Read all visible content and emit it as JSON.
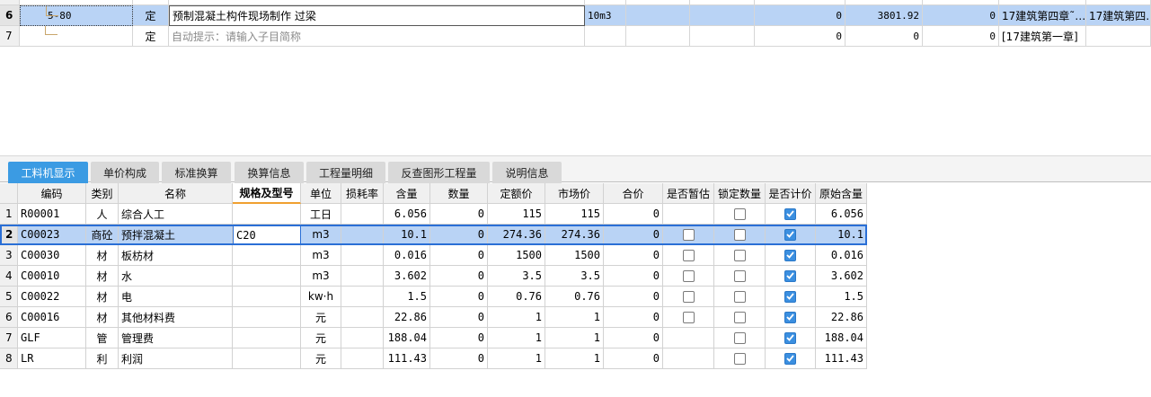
{
  "top_grid": {
    "partial_row": {
      "cells": [
        "",
        "",
        "",
        "",
        "",
        "",
        "",
        "",
        "",
        ""
      ]
    },
    "rows": [
      {
        "index": "6",
        "code": "5-80",
        "type": "定",
        "name": "预制混凝土构件现场制作 过梁",
        "unit": "10m3",
        "c1": "",
        "c2": "",
        "c3": "0",
        "c4": "3801.92",
        "c5": "0",
        "chapter": "17建筑第四章˜…",
        "chapter2": "17建筑第四…"
      },
      {
        "index": "7",
        "code": "",
        "type": "定",
        "name": "自动提示：请输入子目简称",
        "unit": "",
        "c1": "",
        "c2": "",
        "c3": "0",
        "c4": "0",
        "c5": "0",
        "chapter": "[17建筑第一章]",
        "chapter2": ""
      }
    ]
  },
  "tabs": [
    {
      "label": "工料机显示",
      "active": true
    },
    {
      "label": "单价构成",
      "active": false
    },
    {
      "label": "标准换算",
      "active": false
    },
    {
      "label": "换算信息",
      "active": false
    },
    {
      "label": "工程量明细",
      "active": false
    },
    {
      "label": "反查图形工程量",
      "active": false
    },
    {
      "label": "说明信息",
      "active": false
    }
  ],
  "table": {
    "headers": [
      "编码",
      "类别",
      "名称",
      "规格及型号",
      "单位",
      "损耗率",
      "含量",
      "数量",
      "定额价",
      "市场价",
      "合价",
      "是否暂估",
      "锁定数量",
      "是否计价",
      "原始含量"
    ],
    "rows": [
      {
        "idx": "1",
        "code": "R00001",
        "cat": "人",
        "name": "综合人工",
        "spec": "",
        "unit": "工日",
        "loss": "",
        "qty": "6.056",
        "amount": "0",
        "quota": "115",
        "market": "115",
        "total": "0",
        "est": null,
        "lock": false,
        "priced": true,
        "orig": "6.056"
      },
      {
        "idx": "2",
        "code": "C00023",
        "cat": "商砼",
        "name": "预拌混凝土",
        "spec": "C20",
        "unit": "m3",
        "loss": "",
        "qty": "10.1",
        "amount": "0",
        "quota": "274.36",
        "market": "274.36",
        "total": "0",
        "est": false,
        "lock": false,
        "priced": true,
        "orig": "10.1"
      },
      {
        "idx": "3",
        "code": "C00030",
        "cat": "材",
        "name": "板枋材",
        "spec": "",
        "unit": "m3",
        "loss": "",
        "qty": "0.016",
        "amount": "0",
        "quota": "1500",
        "market": "1500",
        "total": "0",
        "est": false,
        "lock": false,
        "priced": true,
        "orig": "0.016"
      },
      {
        "idx": "4",
        "code": "C00010",
        "cat": "材",
        "name": "水",
        "spec": "",
        "unit": "m3",
        "loss": "",
        "qty": "3.602",
        "amount": "0",
        "quota": "3.5",
        "market": "3.5",
        "total": "0",
        "est": false,
        "lock": false,
        "priced": true,
        "orig": "3.602"
      },
      {
        "idx": "5",
        "code": "C00022",
        "cat": "材",
        "name": "电",
        "spec": "",
        "unit": "kw·h",
        "loss": "",
        "qty": "1.5",
        "amount": "0",
        "quota": "0.76",
        "market": "0.76",
        "total": "0",
        "est": false,
        "lock": false,
        "priced": true,
        "orig": "1.5"
      },
      {
        "idx": "6",
        "code": "C00016",
        "cat": "材",
        "name": "其他材料费",
        "spec": "",
        "unit": "元",
        "loss": "",
        "qty": "22.86",
        "amount": "0",
        "quota": "1",
        "market": "1",
        "total": "0",
        "est": false,
        "lock": false,
        "priced": true,
        "orig": "22.86"
      },
      {
        "idx": "7",
        "code": "GLF",
        "cat": "管",
        "name": "管理费",
        "spec": "",
        "unit": "元",
        "loss": "",
        "qty": "188.04",
        "amount": "0",
        "quota": "1",
        "market": "1",
        "total": "0",
        "est": null,
        "lock": false,
        "priced": true,
        "orig": "188.04"
      },
      {
        "idx": "8",
        "code": "LR",
        "cat": "利",
        "name": "利润",
        "spec": "",
        "unit": "元",
        "loss": "",
        "qty": "111.43",
        "amount": "0",
        "quota": "1",
        "market": "1",
        "total": "0",
        "est": null,
        "lock": false,
        "priced": true,
        "orig": "111.43"
      }
    ]
  },
  "colors": {
    "selection": "#b9d3f5",
    "tab_active": "#3b9be3",
    "checkbox_on": "#3b8fe0"
  }
}
